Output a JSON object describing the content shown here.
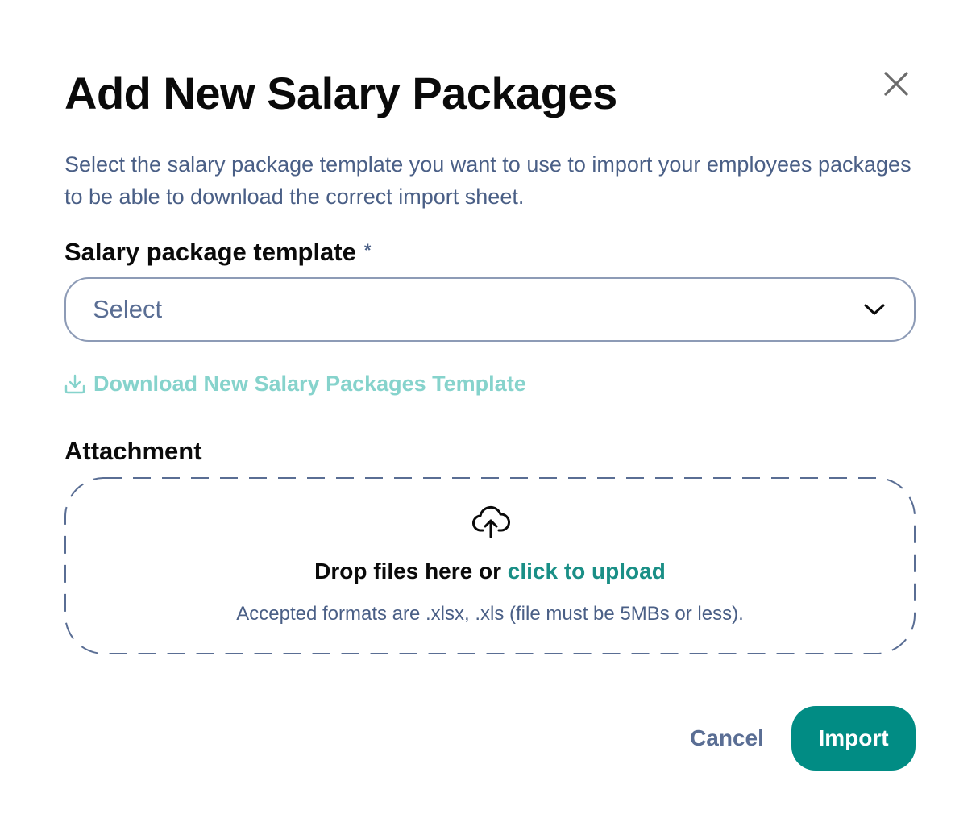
{
  "dialog": {
    "title": "Add New Salary Packages",
    "description": "Select the salary package template you want to use to import your employees packages to be able to download the correct import sheet."
  },
  "template_field": {
    "label": "Salary package template",
    "required_marker": "*",
    "value": "Select"
  },
  "download_link": {
    "label": "Download New Salary Packages Template"
  },
  "attachment": {
    "label": "Attachment",
    "drop_prefix": "Drop files here or ",
    "drop_link": "click to upload",
    "formats_note": "Accepted formats are .xlsx, .xls (file must be 5MBs or less)."
  },
  "actions": {
    "cancel_label": "Cancel",
    "import_label": "Import"
  },
  "icons": {
    "close": "close-icon",
    "chevron": "chevron-down-icon",
    "download": "download-icon",
    "upload": "cloud-upload-icon"
  },
  "colors": {
    "primary": "#018c84",
    "link_teal": "#1a8f86",
    "link_disabled": "#86d3cc",
    "muted_text": "#4a5f86",
    "border": "#8d9bb6"
  }
}
